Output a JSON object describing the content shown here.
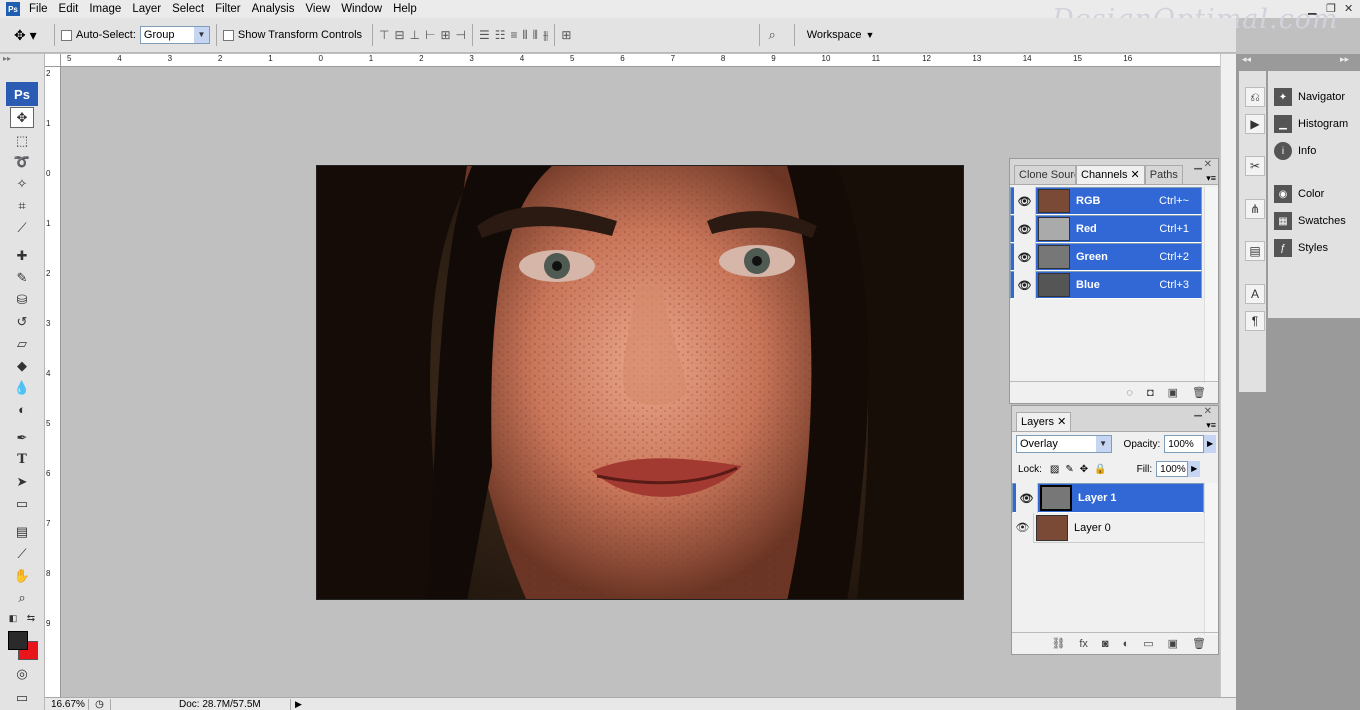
{
  "menu": [
    "File",
    "Edit",
    "Image",
    "Layer",
    "Select",
    "Filter",
    "Analysis",
    "View",
    "Window",
    "Help"
  ],
  "watermark": "DesignOptimal.com",
  "options": {
    "auto_select_label": "Auto-Select:",
    "auto_select_value": "Group",
    "transform_label": "Show Transform Controls",
    "workspace_label": "Workspace"
  },
  "ruler": {
    "top": [
      "5",
      "4",
      "3",
      "2",
      "1",
      "0",
      "1",
      "2",
      "3",
      "4",
      "5",
      "6",
      "7",
      "8",
      "9",
      "10",
      "11",
      "12",
      "13",
      "14",
      "15",
      "16"
    ],
    "left": [
      "2",
      "1",
      "0",
      "1",
      "2",
      "3",
      "4",
      "5",
      "6",
      "7",
      "8",
      "9"
    ]
  },
  "status": {
    "zoom": "16.67%",
    "doc": "Doc: 28.7M/57.5M"
  },
  "channels_panel": {
    "tabs": [
      "Clone Sourc",
      "Channels",
      "Paths"
    ],
    "rows": [
      {
        "name": "RGB",
        "shortcut": "Ctrl+~"
      },
      {
        "name": "Red",
        "shortcut": "Ctrl+1"
      },
      {
        "name": "Green",
        "shortcut": "Ctrl+2"
      },
      {
        "name": "Blue",
        "shortcut": "Ctrl+3"
      }
    ]
  },
  "layers_panel": {
    "tab": "Layers",
    "blend_mode": "Overlay",
    "opacity_label": "Opacity:",
    "opacity": "100%",
    "lock_label": "Lock:",
    "fill_label": "Fill:",
    "fill": "100%",
    "layers": [
      {
        "name": "Layer 1"
      },
      {
        "name": "Layer 0"
      }
    ]
  },
  "dock": {
    "group1": [
      "Navigator",
      "Histogram",
      "Info"
    ],
    "group2": [
      "Color",
      "Swatches",
      "Styles"
    ]
  },
  "icons": {
    "eye": "eye-icon",
    "move": "move-tool-icon"
  },
  "colors": {
    "selection": "#3168d5",
    "foreground": "#2a2a2a",
    "background": "#e8151b"
  }
}
